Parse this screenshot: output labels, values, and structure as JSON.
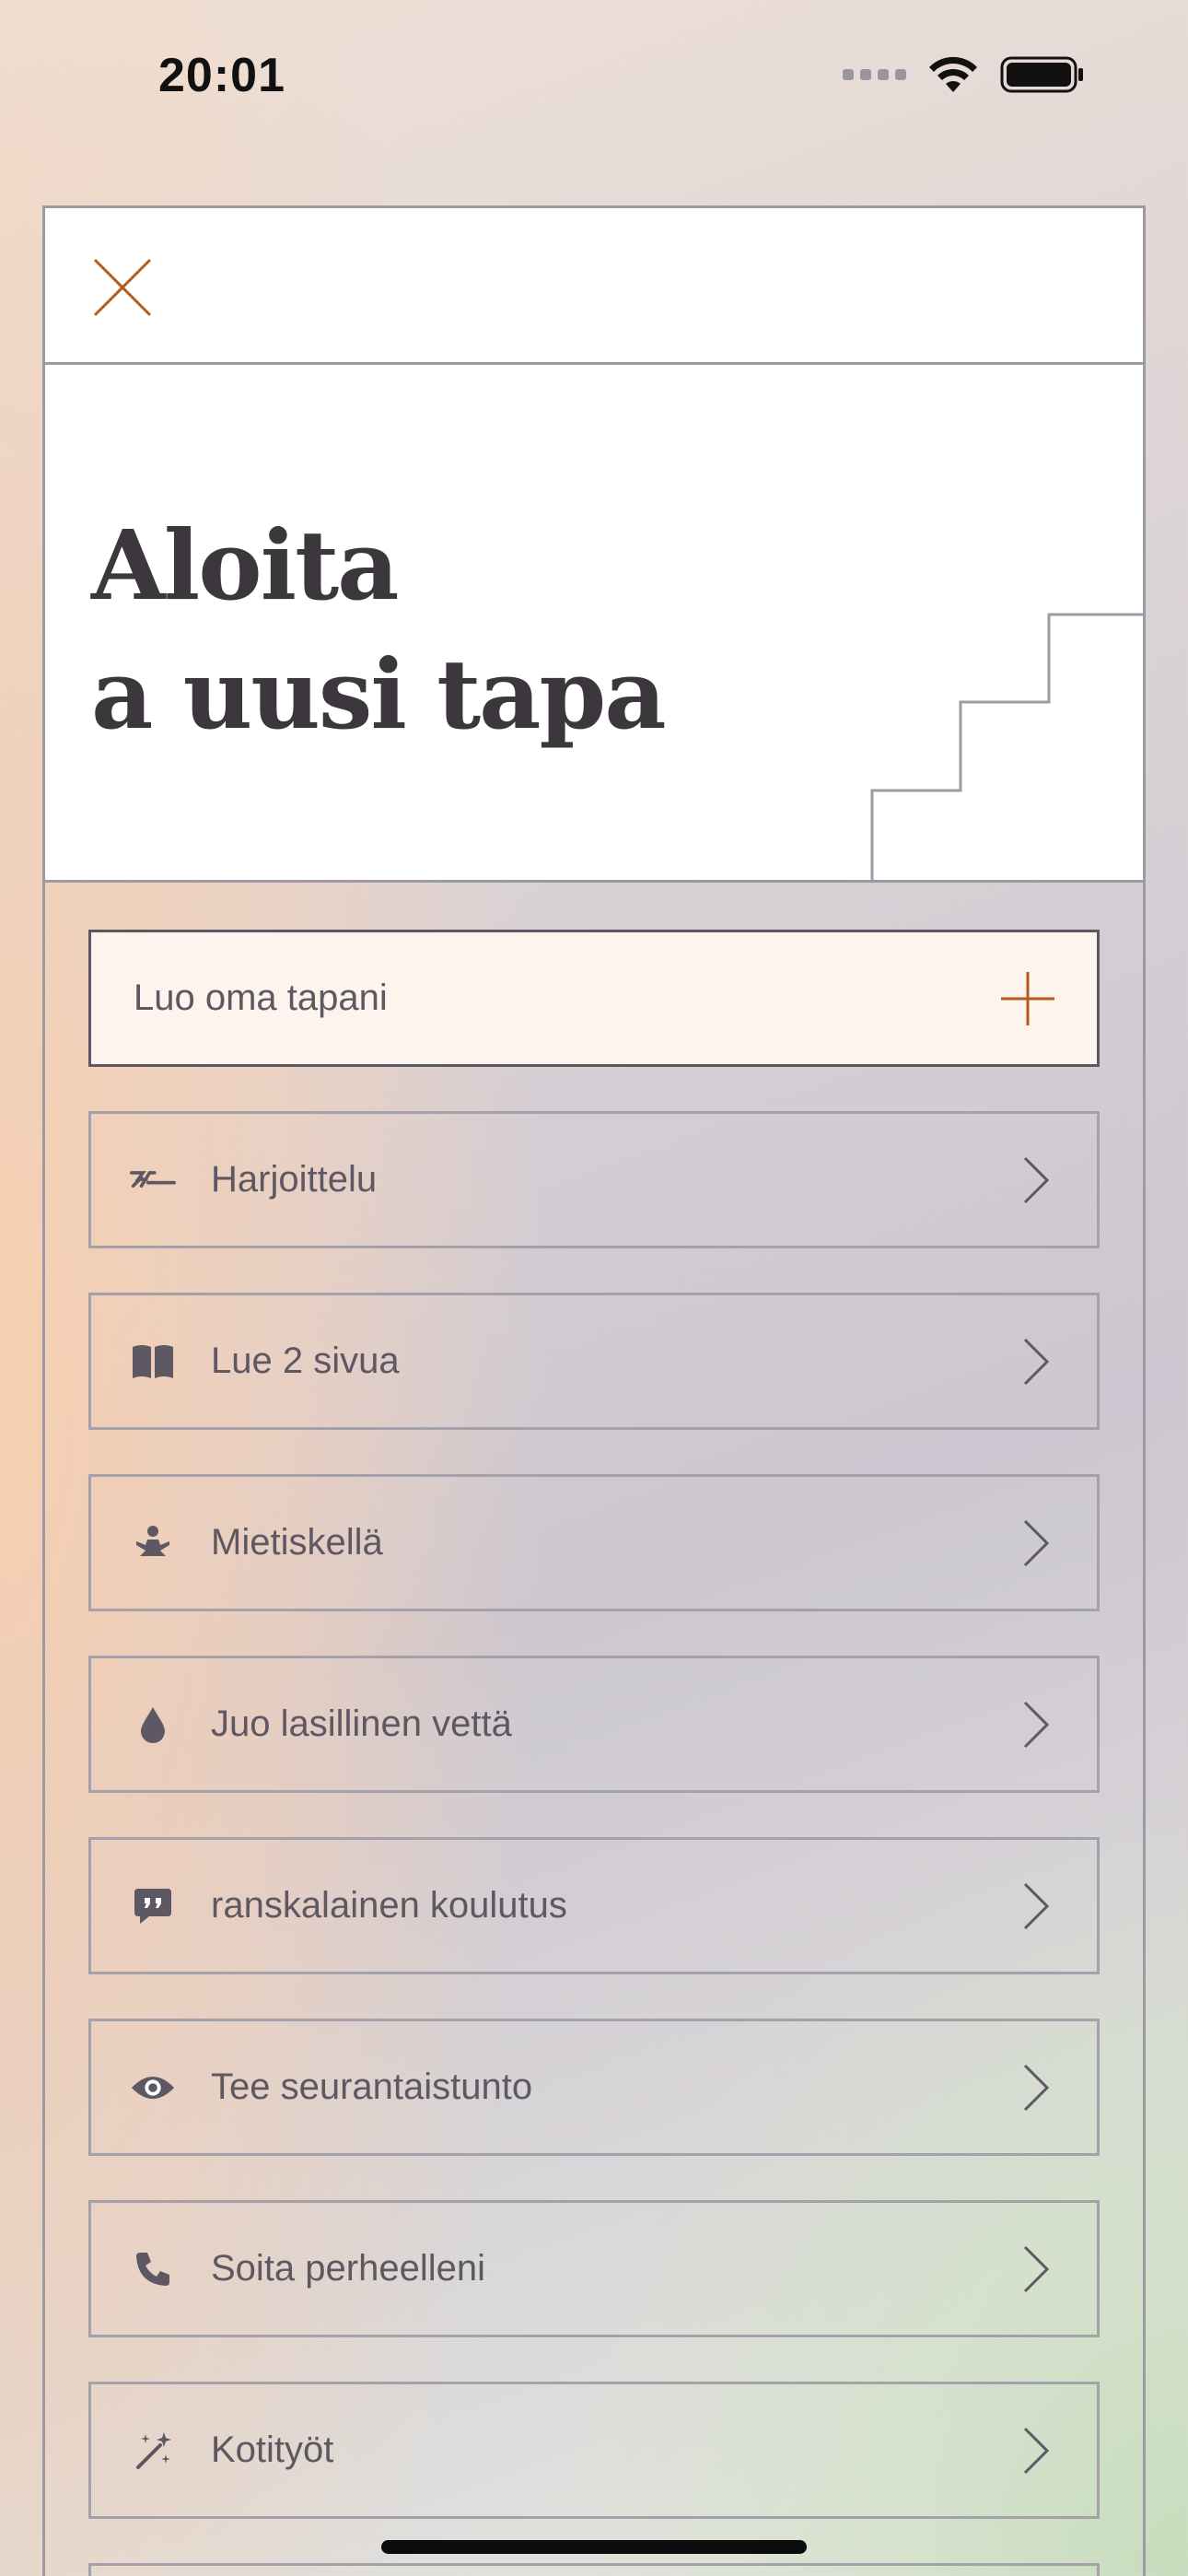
{
  "status_bar": {
    "time": "20:01"
  },
  "sheet": {
    "title_line1": "Aloita",
    "title_line2": "a uusi tapa",
    "create_label": "Luo oma tapani",
    "habits": [
      {
        "label": "Harjoittelu",
        "icon": "workout-icon"
      },
      {
        "label": "Lue 2 sivua",
        "icon": "book-icon"
      },
      {
        "label": "Mietiskellä",
        "icon": "meditation-icon"
      },
      {
        "label": "Juo lasillinen vettä",
        "icon": "water-drop-icon"
      },
      {
        "label": "ranskalainen koulutus",
        "icon": "speech-bubble-icon"
      },
      {
        "label": "Tee seurantaistunto",
        "icon": "eye-icon"
      },
      {
        "label": "Soita perheelleni",
        "icon": "phone-icon"
      },
      {
        "label": "Kotityöt",
        "icon": "sparkles-icon"
      }
    ]
  },
  "colors": {
    "accent": "#b35a1f",
    "text": "#5d5862",
    "title": "#3b373d",
    "border": "#a5a1ab",
    "create_bg": "#fdf4ee"
  }
}
